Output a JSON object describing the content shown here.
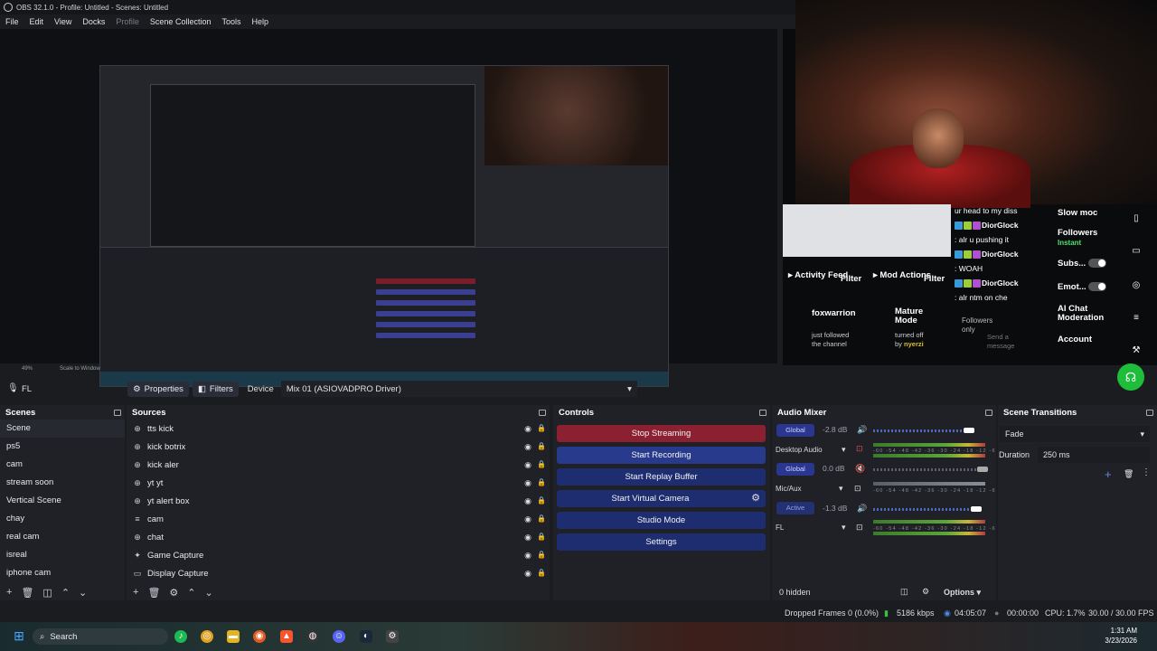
{
  "window": {
    "title": "OBS 32.1.0 - Profile: Untitled - Scenes: Untitled"
  },
  "menu": [
    "File",
    "Edit",
    "View",
    "Docks",
    "Profile",
    "Scene Collection",
    "Tools",
    "Help"
  ],
  "preview": {
    "zoom": "49%",
    "scale_mode": "Scale to Window"
  },
  "chat_overlay": {
    "messages": [
      {
        "user": "",
        "text": "ur head to my diss"
      },
      {
        "user": "DiorGlock",
        "text": ""
      },
      {
        "user": "",
        "text": ": alr u pushing it"
      },
      {
        "user": "DiorGlock",
        "text": ""
      },
      {
        "user": "",
        "text": ": WOAH"
      },
      {
        "user": "DiorGlock",
        "text": ""
      },
      {
        "user": "",
        "text": ": alr ntm on che"
      }
    ],
    "settings": [
      "Slow moc",
      "Followers",
      "Instant",
      "Subs...",
      "Emot...",
      "AI Chat",
      "Moderation",
      "Account"
    ],
    "activity_feed": "Activity Feed",
    "filter_label": "Filter",
    "mod_actions": "Mod Actions",
    "follower_name": "foxwarrion",
    "follower_text": "just followed the channel",
    "mature_mode": "Mature Mode",
    "mature_text": "turned off by",
    "mature_user": "nyerzi",
    "followers_only": "Followers only",
    "send_message": "Send a message"
  },
  "source_bar": {
    "mic_icon": "microphone-icon",
    "source_name": "FL"
  },
  "properties_button": "Properties",
  "filters_button": "Filters",
  "device_label": "Device",
  "device_value": "Mix 01 (ASIOVADPRO Driver)",
  "scenes": {
    "title": "Scenes",
    "items": [
      "Scene",
      "ps5",
      "cam",
      "stream soon",
      "Vertical Scene",
      "chay",
      "real cam",
      "isreal",
      "iphone cam"
    ]
  },
  "sources": {
    "title": "Sources",
    "items": [
      {
        "name": "tts kick",
        "icon": "globe-icon"
      },
      {
        "name": "kick botrix",
        "icon": "globe-icon"
      },
      {
        "name": "kick aler",
        "icon": "globe-icon"
      },
      {
        "name": "yt yt",
        "icon": "globe-icon"
      },
      {
        "name": "yt alert box",
        "icon": "globe-icon"
      },
      {
        "name": "cam",
        "icon": "list-icon"
      },
      {
        "name": "chat",
        "icon": "globe-icon"
      },
      {
        "name": "Game Capture",
        "icon": "gamepad-icon"
      },
      {
        "name": "Display Capture",
        "icon": "monitor-icon"
      }
    ]
  },
  "controls": {
    "title": "Controls",
    "buttons": [
      "Stop Streaming",
      "Start Recording",
      "Start Replay Buffer",
      "Start Virtual Camera",
      "Studio Mode",
      "Settings"
    ]
  },
  "audio_mixer": {
    "title": "Audio Mixer",
    "channels": [
      {
        "mode": "Global",
        "db": "-2.8 dB",
        "name": "Desktop Audio",
        "level": 0.9
      },
      {
        "mode": "Global",
        "db": "0.0 dB",
        "name": "Mic/Aux",
        "level": 1.0
      },
      {
        "mode": "Active",
        "db": "-1.3 dB",
        "name": "FL",
        "level": 0.94
      }
    ],
    "scale": "-60 -54 -48 -42 -36 -30 -24 -18 -12 -6 0",
    "hidden": "0 hidden",
    "options": "Options"
  },
  "transitions": {
    "title": "Scene Transitions",
    "selected": "Fade",
    "duration_label": "Duration",
    "duration_value": "250 ms"
  },
  "status": {
    "dropped": "Dropped Frames 0 (0.0%)",
    "bitrate": "5186 kbps",
    "stream_time": "04:05:07",
    "rec_time": "00:00:00",
    "cpu": "CPU: 1.7%",
    "fps": "30.00 / 30.00 FPS"
  },
  "taskbar": {
    "search": "Search",
    "time": "1:31 AM",
    "date": "3/23/2026"
  }
}
